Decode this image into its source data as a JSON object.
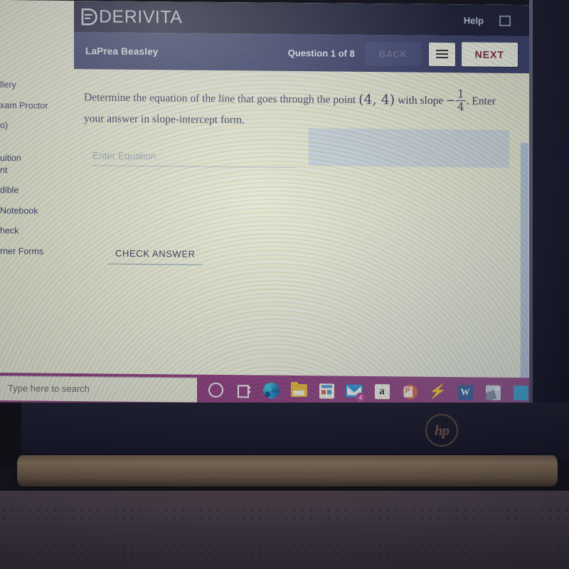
{
  "app": {
    "brand": "DERIVITA",
    "help_label": "Help",
    "fullscreen_icon": "fullscreen-icon",
    "student_name": "LaPrea Beasley",
    "question_counter": "Question 1 of 8",
    "back_label": "BACK",
    "menu_icon": "list-menu-icon",
    "next_label": "NEXT",
    "colors": {
      "top_bar": "#1c1f3c",
      "sub_bar": "#3b4170",
      "next_text": "#7d2744",
      "page": "#e9e8d9",
      "hint_panel": "#c8d2e2"
    }
  },
  "question": {
    "part1": "Determine the equation of the line that goes through the point ",
    "point": "(4, 4)",
    "part2": " with slope ",
    "minus": "−",
    "fraction_numerator": "1",
    "fraction_denominator": "4",
    "part3": ". Enter your answer in slope-intercept form."
  },
  "answer": {
    "placeholder": "Enter Equation",
    "value": "",
    "check_label": "CHECK ANSWER"
  },
  "sidenav": {
    "items": [
      {
        "label": "llery"
      },
      {
        "label": "xam Proctor"
      },
      {
        "label": "o)"
      },
      {
        "label": "uition"
      },
      {
        "label": "nt"
      },
      {
        "label": "dible"
      },
      {
        "label": "Notebook"
      },
      {
        "label": "heck"
      },
      {
        "label": "rner Forms"
      }
    ]
  },
  "taskbar": {
    "search_placeholder": "Type here to search",
    "icons": [
      {
        "name": "cortana-circle-icon"
      },
      {
        "name": "task-view-icon"
      },
      {
        "name": "microsoft-edge-icon"
      },
      {
        "name": "file-explorer-icon"
      },
      {
        "name": "microsoft-store-icon"
      },
      {
        "name": "mail-icon",
        "badge": "4"
      },
      {
        "name": "amazon-icon",
        "glyph": "a"
      },
      {
        "name": "powerpoint-icon"
      },
      {
        "name": "lightning-bolt-icon",
        "glyph": "⚡"
      },
      {
        "name": "word-icon",
        "glyph": "W"
      },
      {
        "name": "photos-icon"
      },
      {
        "name": "partial-app-icon"
      }
    ]
  },
  "hardware": {
    "brand_logo": "hp"
  }
}
